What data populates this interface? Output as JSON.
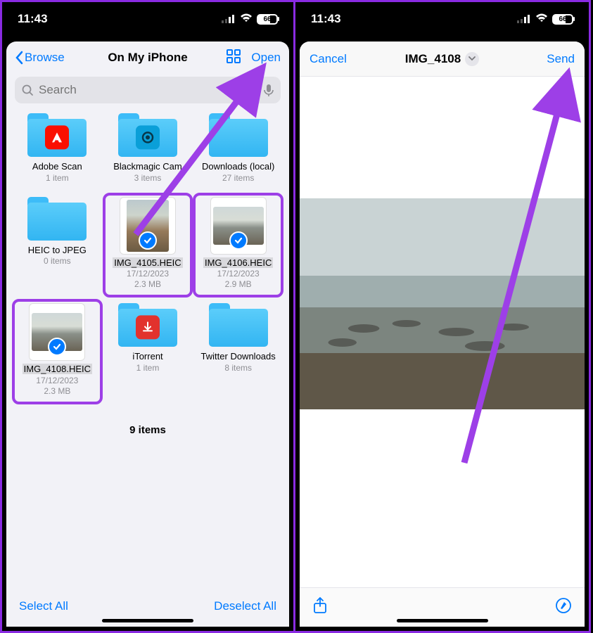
{
  "status": {
    "time": "11:43",
    "battery": "66"
  },
  "left": {
    "back": "Browse",
    "title": "On My iPhone",
    "open": "Open",
    "search_placeholder": "Search",
    "folders_row1": [
      {
        "name": "Adobe Scan",
        "meta": "1 item",
        "icon": "adobe"
      },
      {
        "name": "Blackmagic Cam",
        "meta": "3 items",
        "icon": "camera"
      },
      {
        "name": "Downloads (local)",
        "meta": "27 items",
        "icon": ""
      }
    ],
    "row2": [
      {
        "type": "folder",
        "name": "HEIC to JPEG",
        "meta": "0 items"
      },
      {
        "type": "img",
        "name": "IMG_4105.HEIC",
        "date": "17/12/2023",
        "size": "2.3 MB",
        "selected": true,
        "hl": true,
        "wide": false
      },
      {
        "type": "img",
        "name": "IMG_4106.HEIC",
        "date": "17/12/2023",
        "size": "2.9 MB",
        "selected": true,
        "hl": true,
        "wide": true
      }
    ],
    "row3": [
      {
        "type": "img",
        "name": "IMG_4108.HEIC",
        "date": "17/12/2023",
        "size": "2.3 MB",
        "selected": true,
        "hl": true,
        "wide": true,
        "box": true
      },
      {
        "type": "folder",
        "name": "iTorrent",
        "meta": "1 item",
        "icon": "itorrent"
      },
      {
        "type": "folder",
        "name": "Twitter Downloads",
        "meta": "8 items"
      }
    ],
    "summary": "9 items",
    "select_all": "Select All",
    "deselect_all": "Deselect All"
  },
  "right": {
    "cancel": "Cancel",
    "title": "IMG_4108",
    "send": "Send"
  }
}
